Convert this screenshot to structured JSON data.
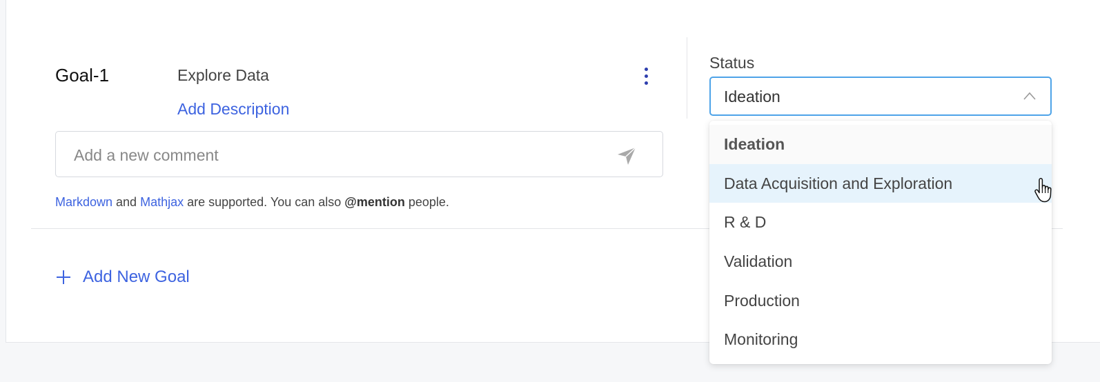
{
  "goal": {
    "id": "Goal-1",
    "title": "Explore Data",
    "add_description": "Add Description"
  },
  "comment": {
    "placeholder": "Add a new comment",
    "hint": {
      "markdown_link": "Markdown",
      "and": " and ",
      "mathjax_link": "Mathjax",
      "supported": " are supported. You can also ",
      "mention": "@mention",
      "people": " people."
    }
  },
  "add_new_goal": "Add New Goal",
  "status": {
    "label": "Status",
    "selected": "Ideation",
    "options": [
      "Ideation",
      "Data Acquisition and Exploration",
      "R & D",
      "Validation",
      "Production",
      "Monitoring"
    ]
  },
  "colors": {
    "link": "#3d63e0",
    "focus_border": "#4da3e8",
    "hover_bg": "#e6f3fc"
  },
  "icons": [
    "kebab-menu-icon",
    "send-icon",
    "plus-icon",
    "chevron-up-icon",
    "hand-pointer-icon"
  ]
}
